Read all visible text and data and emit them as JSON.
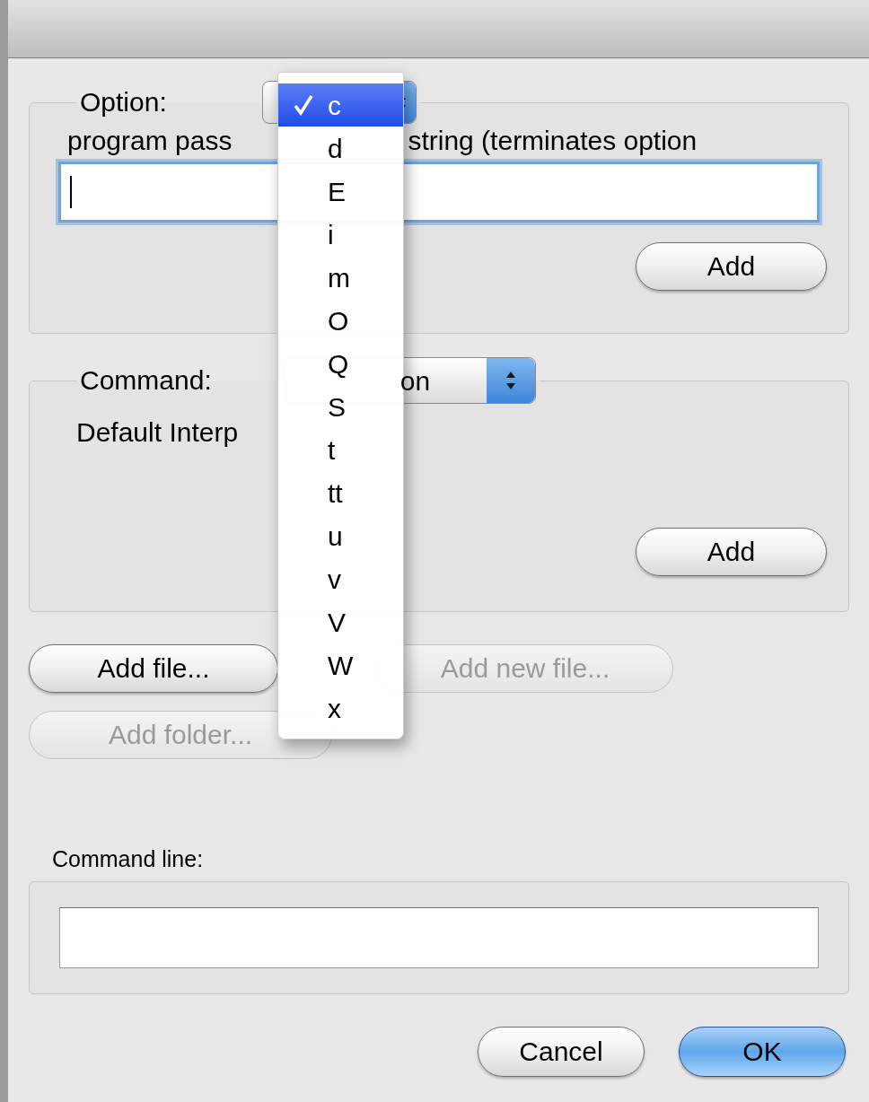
{
  "dialog": {
    "option_group": {
      "legend": "Option:",
      "menu": [
        {
          "label": "c",
          "selected": true
        },
        {
          "label": "d",
          "selected": false
        },
        {
          "label": "E",
          "selected": false
        },
        {
          "label": "i",
          "selected": false
        },
        {
          "label": "m",
          "selected": false
        },
        {
          "label": "O",
          "selected": false
        },
        {
          "label": "Q",
          "selected": false
        },
        {
          "label": "S",
          "selected": false
        },
        {
          "label": "t",
          "selected": false
        },
        {
          "label": "tt",
          "selected": false
        },
        {
          "label": "u",
          "selected": false
        },
        {
          "label": "v",
          "selected": false
        },
        {
          "label": "V",
          "selected": false
        },
        {
          "label": "W",
          "selected": false
        },
        {
          "label": "x",
          "selected": false
        }
      ],
      "description_left": "program pass",
      "description_right": "string (terminates option",
      "input": {
        "focused": true
      },
      "add_button": "Add"
    },
    "command_group": {
      "legend": "Command:",
      "popup_value": "on",
      "description": "Default Interp",
      "add_button": "Add"
    },
    "file_buttons": [
      {
        "label": "Add file...",
        "disabled": false
      },
      {
        "label": "Add new file...",
        "disabled": true
      },
      {
        "label": "Add folder...",
        "disabled": true
      }
    ],
    "command_line": {
      "label": "Command line:"
    },
    "buttons": [
      {
        "label": "Cancel",
        "default": false
      },
      {
        "label": "OK",
        "default": true
      }
    ]
  }
}
